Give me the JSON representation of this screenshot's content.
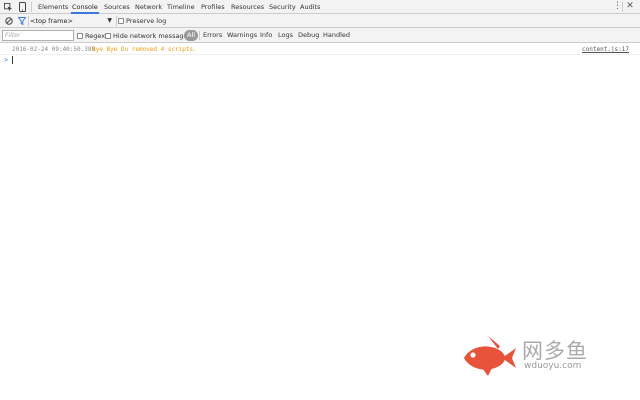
{
  "colors": {
    "accent": "#3879d9",
    "warning_text": "#f39c12",
    "all_badge": "#999999",
    "logo_fish": "#e8533c"
  },
  "tabs": [
    {
      "label": "Elements"
    },
    {
      "label": "Console",
      "selected": true
    },
    {
      "label": "Sources"
    },
    {
      "label": "Network"
    },
    {
      "label": "Timeline"
    },
    {
      "label": "Profiles"
    },
    {
      "label": "Resources"
    },
    {
      "label": "Security"
    },
    {
      "label": "Audits"
    }
  ],
  "icons": {
    "inspect": "inspect-element-icon",
    "device": "device-mode-icon",
    "more": "more-vertical-icon",
    "close": "close-icon",
    "clear": "clear-console-icon",
    "filter": "filter-icon"
  },
  "toolbar": {
    "frame": "<top frame>",
    "preserve_log": "Preserve log",
    "filter_placeholder": "Filter",
    "regex": "Regex",
    "hide_network": "Hide network messages",
    "levels": [
      "All",
      "Errors",
      "Warnings",
      "Info",
      "Logs",
      "Debug",
      "Handled"
    ]
  },
  "console": {
    "messages": [
      {
        "timestamp": "2016-02-24 09:40:50.389",
        "text": "Bye Bye Du removed 4 scripts.",
        "source": "content.js:17"
      }
    ],
    "prompt": ">"
  },
  "watermark": {
    "cn": "网多鱼",
    "en": "wduoyu.com"
  }
}
